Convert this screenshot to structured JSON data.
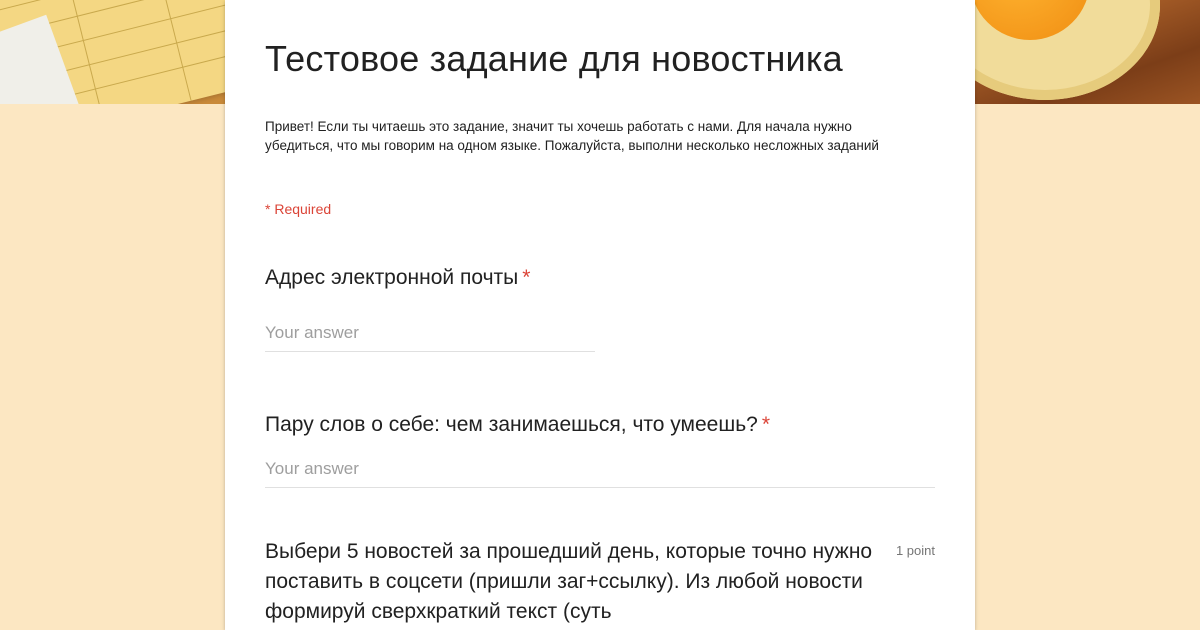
{
  "form": {
    "title": "Тестовое задание для новостника",
    "description": "Привет! Если ты читаешь это задание, значит ты хочешь работать с нами. Для начала нужно убедиться, что мы говорим на одном языке. Пожалуйста, выполни несколько несложных заданий",
    "required_note": "* Required"
  },
  "questions": [
    {
      "label": "Адрес электронной почты",
      "required_mark": "*",
      "placeholder": "Your answer"
    },
    {
      "label": "Пару слов о себе: чем занимаешься, что умеешь?",
      "required_mark": "*",
      "placeholder": "Your answer"
    },
    {
      "label": "Выбери 5 новостей за прошедший день, которые точно нужно поставить в соцсети (пришли заг+ссылку). Из любой новости формируй сверхкраткий текст (суть",
      "points": "1 point"
    }
  ],
  "colors": {
    "background": "#fce7c2",
    "required": "#db4437",
    "text": "#212121",
    "placeholder": "#9e9e9e"
  }
}
